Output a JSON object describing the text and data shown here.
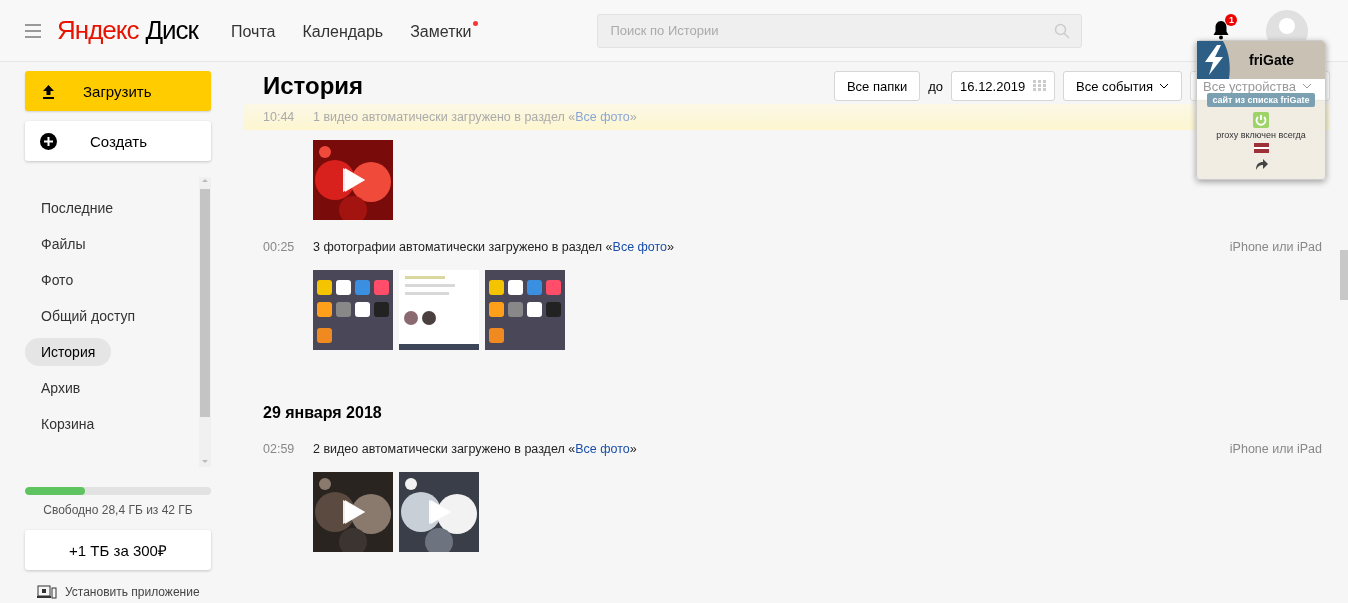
{
  "header": {
    "brand": {
      "first": "Яндекс",
      "second": "Диск"
    },
    "nav": [
      {
        "label": "Почта",
        "dot": false
      },
      {
        "label": "Календарь",
        "dot": false
      },
      {
        "label": "Заметки",
        "dot": true
      }
    ],
    "search": {
      "placeholder": "Поиск по Истории"
    },
    "notifications": {
      "count": "1"
    }
  },
  "sidebar": {
    "upload": "Загрузить",
    "create": "Создать",
    "items": [
      {
        "label": "Последние",
        "selected": false
      },
      {
        "label": "Файлы",
        "selected": false
      },
      {
        "label": "Фото",
        "selected": false
      },
      {
        "label": "Общий доступ",
        "selected": false
      },
      {
        "label": "История",
        "selected": true
      },
      {
        "label": "Архив",
        "selected": false
      },
      {
        "label": "Корзина",
        "selected": false
      }
    ],
    "storage": {
      "level": 0.32,
      "text": "Свободно 28,4 ГБ из 42 ГБ"
    },
    "buy": "+1 ТБ за 300₽",
    "install": "Установить приложение"
  },
  "page": {
    "title": "История",
    "filters": {
      "folders": "Все папки",
      "until_label": "до",
      "date": "16.12.2019",
      "events": "Все события",
      "devices": "Все устройства"
    }
  },
  "sections": [
    {
      "events": [
        {
          "time": "10:44",
          "text": "1 видео автоматически загружено в раздел «",
          "link": "Все фото",
          "after": "»",
          "highlighted": true,
          "thumbs": [
            {
              "kind": "video"
            }
          ]
        },
        {
          "time": "00:25",
          "text": "3 фотографии автоматически загружено в раздел «",
          "link": "Все фото",
          "after": "»",
          "device": "iPhone или iPad",
          "highlighted": false
        }
      ]
    },
    {
      "date": "29 января 2018",
      "events": [
        {
          "time": "02:59",
          "text": "2 видео автоматически загружено в раздел «",
          "link": "Все фото",
          "after": "»",
          "device": "iPhone или iPad",
          "highlighted": false,
          "thumbs": [
            {
              "kind": "video"
            },
            {
              "kind": "video"
            }
          ]
        }
      ]
    }
  ],
  "frigate": {
    "title": "friGate",
    "badge": "сайт из списка friGate",
    "status": "proxy включен всегда"
  }
}
